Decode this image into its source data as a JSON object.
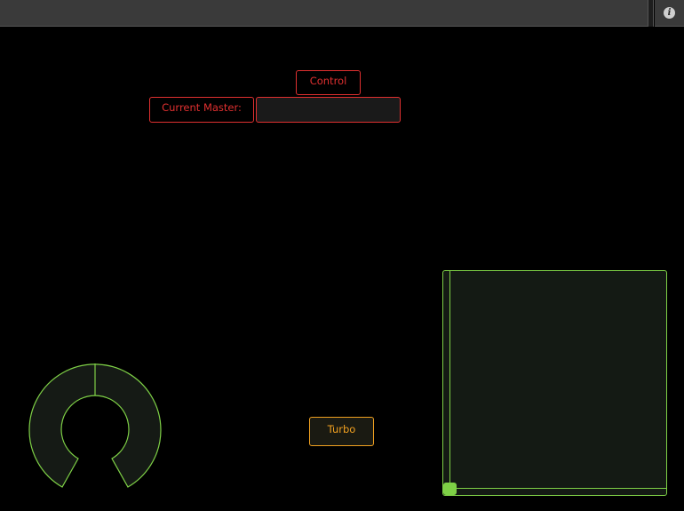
{
  "toolbar": {
    "info_icon": "info-icon"
  },
  "controls": {
    "control_label": "Control",
    "current_master_label": "Current Master:",
    "current_master_value": "",
    "turbo_label": "Turbo"
  },
  "knob": {
    "value": 0.5
  },
  "xy_pad": {
    "x": 0.0,
    "y": 0.0
  },
  "colors": {
    "background": "#000000",
    "toolbar": "#3a3a3a",
    "red_accent": "#e03030",
    "orange_accent": "#f0a020",
    "green_accent": "#7ed046"
  }
}
